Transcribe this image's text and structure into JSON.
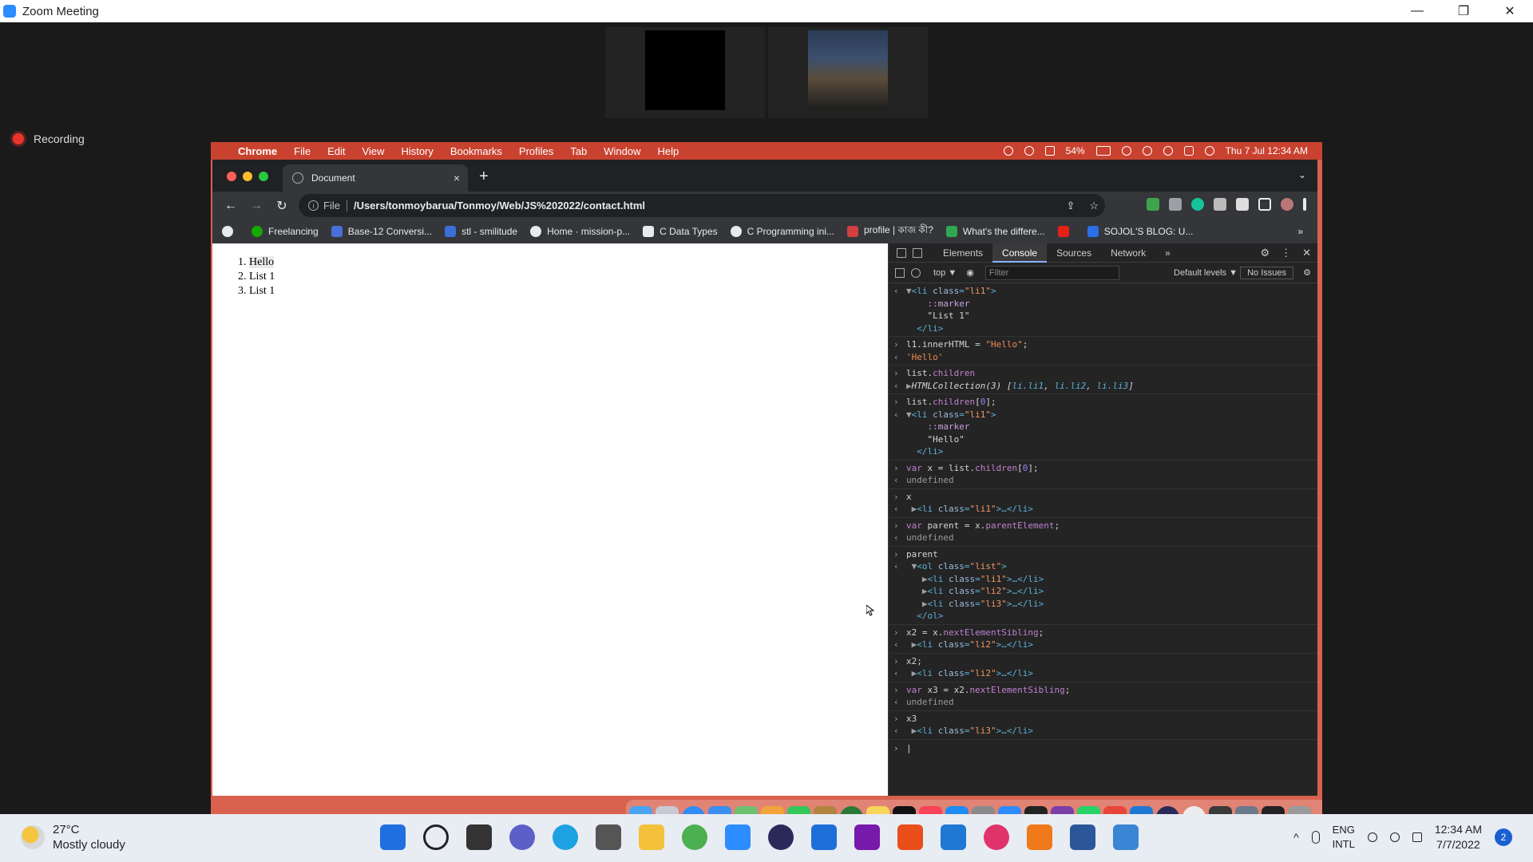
{
  "zoom": {
    "window_title": "Zoom Meeting",
    "recording_label": "Recording",
    "min_glyph": "—",
    "restore_glyph": "❐",
    "close_glyph": "✕"
  },
  "mac": {
    "apple": "",
    "menus": [
      "Chrome",
      "File",
      "Edit",
      "View",
      "History",
      "Bookmarks",
      "Profiles",
      "Tab",
      "Window",
      "Help"
    ],
    "battery": "54%",
    "datetime": "Thu 7 Jul  12:34 AM"
  },
  "chrome": {
    "tab_title": "Document",
    "tab_close": "×",
    "new_tab": "+",
    "tab_dropdown": "⌄",
    "nav": {
      "back": "←",
      "forward": "→",
      "reload": "↻"
    },
    "omnibox": {
      "info": "i",
      "scheme": "File",
      "url": "/Users/tonmoybarua/Tonmoy/Web/JS%202022/contact.html",
      "share": "⇪",
      "star": "☆"
    },
    "bookmarks": [
      {
        "label": "",
        "color": "#e8eaed"
      },
      {
        "label": "Freelancing",
        "color": "#14a800"
      },
      {
        "label": "Base-12 Conversi...",
        "color": "#4a6fd8"
      },
      {
        "label": "stl - smilitude",
        "color": "#3a6fd8"
      },
      {
        "label": "Home · mission-p...",
        "color": "#e8eaed"
      },
      {
        "label": "C Data Types",
        "color": "#e8eaed"
      },
      {
        "label": "C Programming ini...",
        "color": "#e8eaed"
      },
      {
        "label": "profile | কাজ কী?",
        "color": "#d04040"
      },
      {
        "label": "What's the differe...",
        "color": "#2fa84f"
      },
      {
        "label": "",
        "color": "#e62117"
      },
      {
        "label": "SOJOL'S BLOG: U...",
        "color": "#2a6ee8"
      }
    ],
    "bookmarks_more": "»"
  },
  "page": {
    "list": [
      "Hello",
      "List 1",
      "List 1"
    ]
  },
  "devtools": {
    "tabs": [
      "Elements",
      "Console",
      "Sources",
      "Network"
    ],
    "more_tabs": "»",
    "gear": "⚙",
    "kebab": "⋮",
    "close": "✕",
    "context": "top ▼",
    "eye": "◉",
    "filter_placeholder": "Filter",
    "levels": "Default levels ▼",
    "issues": "No Issues"
  },
  "taskbar": {
    "temp": "27°C",
    "condition": "Mostly cloudy",
    "lang1": "ENG",
    "lang2": "INTL",
    "time": "12:34 AM",
    "date": "7/7/2022",
    "notifications": "2",
    "chevron": "^"
  }
}
